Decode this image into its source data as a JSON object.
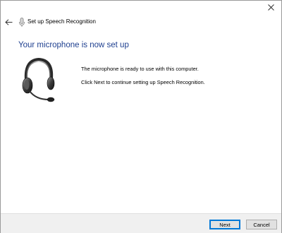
{
  "window": {
    "close_label": "✕"
  },
  "nav": {
    "back_label": "←",
    "title": "Set up Speech Recognition"
  },
  "main": {
    "heading": "Your microphone is now set up",
    "line1": "The microphone is ready to use with this computer.",
    "line2": "Click Next to continue setting up Speech Recognition."
  },
  "footer": {
    "next_label": "Next",
    "cancel_label": "Cancel"
  },
  "colors": {
    "heading": "#1e3f8f",
    "focus_border": "#0078d7",
    "footer_bg": "#f0f0f0"
  },
  "icons": {
    "window_close": "close-icon",
    "back": "back-arrow-icon",
    "title_mic": "microphone-icon",
    "illustration": "headset-icon"
  }
}
